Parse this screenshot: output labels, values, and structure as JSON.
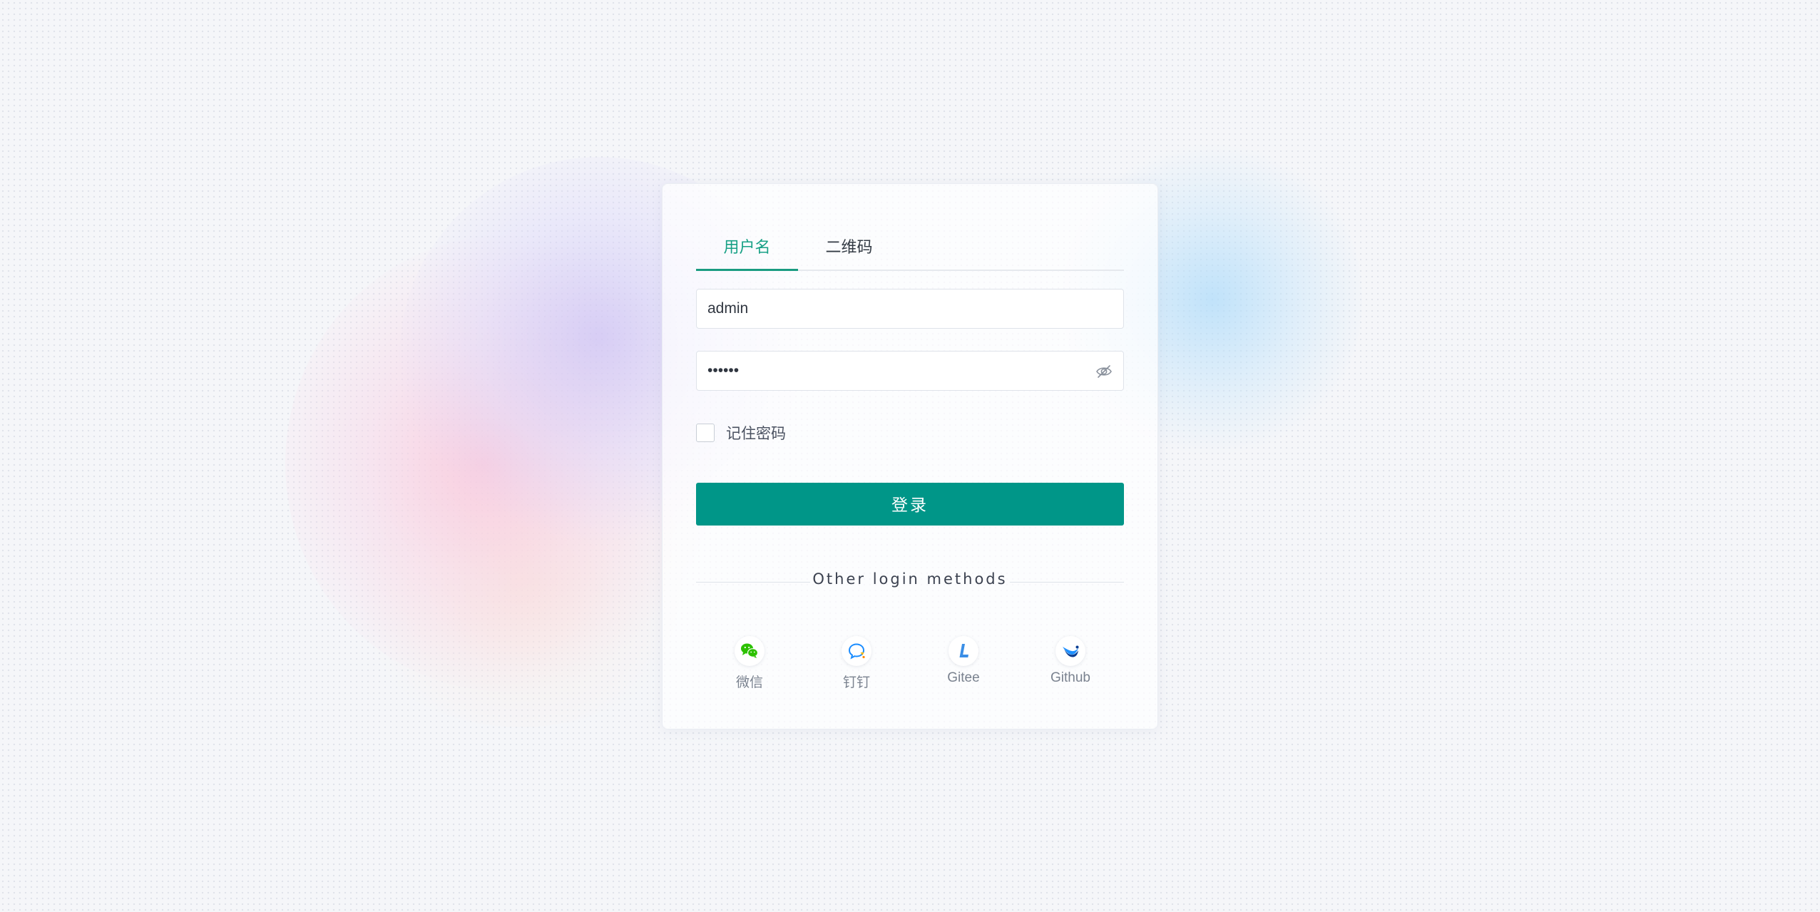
{
  "tabs": [
    {
      "label": "用户名",
      "active": true
    },
    {
      "label": "二维码",
      "active": false
    }
  ],
  "form": {
    "username_value": "admin",
    "password_value": "123456",
    "password_visible": false,
    "remember_label": "记住密码",
    "remember_checked": false,
    "login_label": "登录"
  },
  "divider_text": "Other login methods",
  "methods": [
    {
      "label": "微信",
      "icon": "wechat-icon"
    },
    {
      "label": "钉钉",
      "icon": "dingtalk-icon"
    },
    {
      "label": "Gitee",
      "icon": "gitee-icon"
    },
    {
      "label": "Github",
      "icon": "github-icon"
    }
  ],
  "colors": {
    "accent": "#009688",
    "active_tab": "#17a085",
    "wechat": "#2dc100",
    "dingtalk": "#1a8cff",
    "gitee": "#3a8ee6"
  }
}
